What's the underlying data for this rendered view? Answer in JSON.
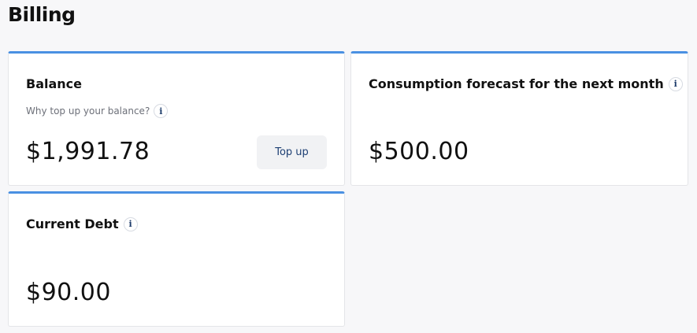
{
  "page": {
    "title": "Billing"
  },
  "balance_card": {
    "title": "Balance",
    "subtitle": "Why top up your balance?",
    "amount": "$1,991.78",
    "topup_label": "Top up"
  },
  "forecast_card": {
    "title": "Consumption forecast for the next month",
    "amount": "$500.00"
  },
  "debt_card": {
    "title": "Current Debt",
    "amount": "$90.00"
  },
  "icons": {
    "info": "i"
  },
  "colors": {
    "accent": "#4a90e2",
    "button_text": "#1d3f73",
    "background": "#f7f7f9"
  }
}
